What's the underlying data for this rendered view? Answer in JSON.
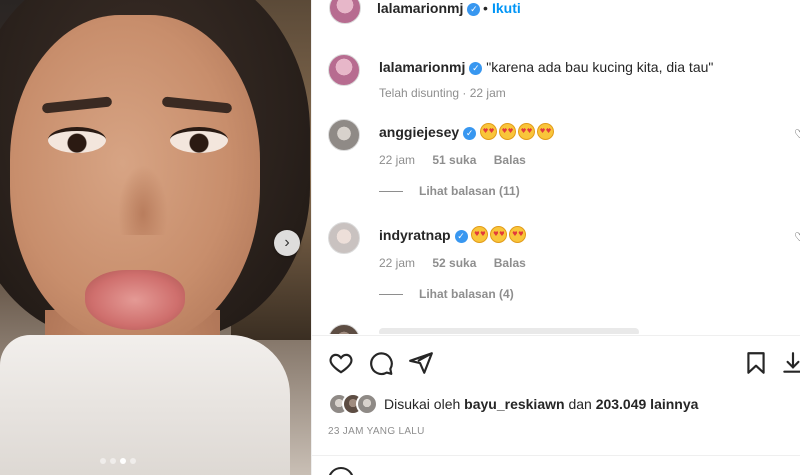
{
  "post": {
    "username": "lalamarionmj",
    "separator": "•",
    "follow_label": "Ikuti",
    "caption": {
      "username": "lalamarionmj",
      "text": "\"karena ada bau kucing kita, dia tau\"",
      "meta": "Telah disunting · 22 jam"
    }
  },
  "comments": [
    {
      "username": "anggiejesey",
      "emoji_count": 4,
      "time": "22 jam",
      "likes": "51 suka",
      "reply_label": "Balas",
      "view_replies": "Lihat balasan (11)"
    },
    {
      "username": "indyratnap",
      "emoji_count": 3,
      "time": "22 jam",
      "likes": "52 suka",
      "reply_label": "Balas",
      "view_replies": "Lihat balasan (4)"
    }
  ],
  "likes_line": {
    "prefix": "Disukai oleh",
    "user": "bayu_reskiawn",
    "conj": "dan",
    "count": "203.049 lainnya"
  },
  "timestamp": "23 JAM YANG LALU",
  "icons": {
    "verified": "verified-badge-icon",
    "like": "heart-icon",
    "comment": "comment-icon",
    "share": "paper-plane-icon",
    "save": "bookmark-icon",
    "download": "download-icon",
    "next": "chevron-right-icon",
    "emoji": "star-struck-emoji"
  },
  "colors": {
    "link": "#0095f6",
    "verified": "#3897f0",
    "muted": "#8e8e8e",
    "text": "#262626"
  },
  "carousel": {
    "slides": 4,
    "active": 2
  }
}
